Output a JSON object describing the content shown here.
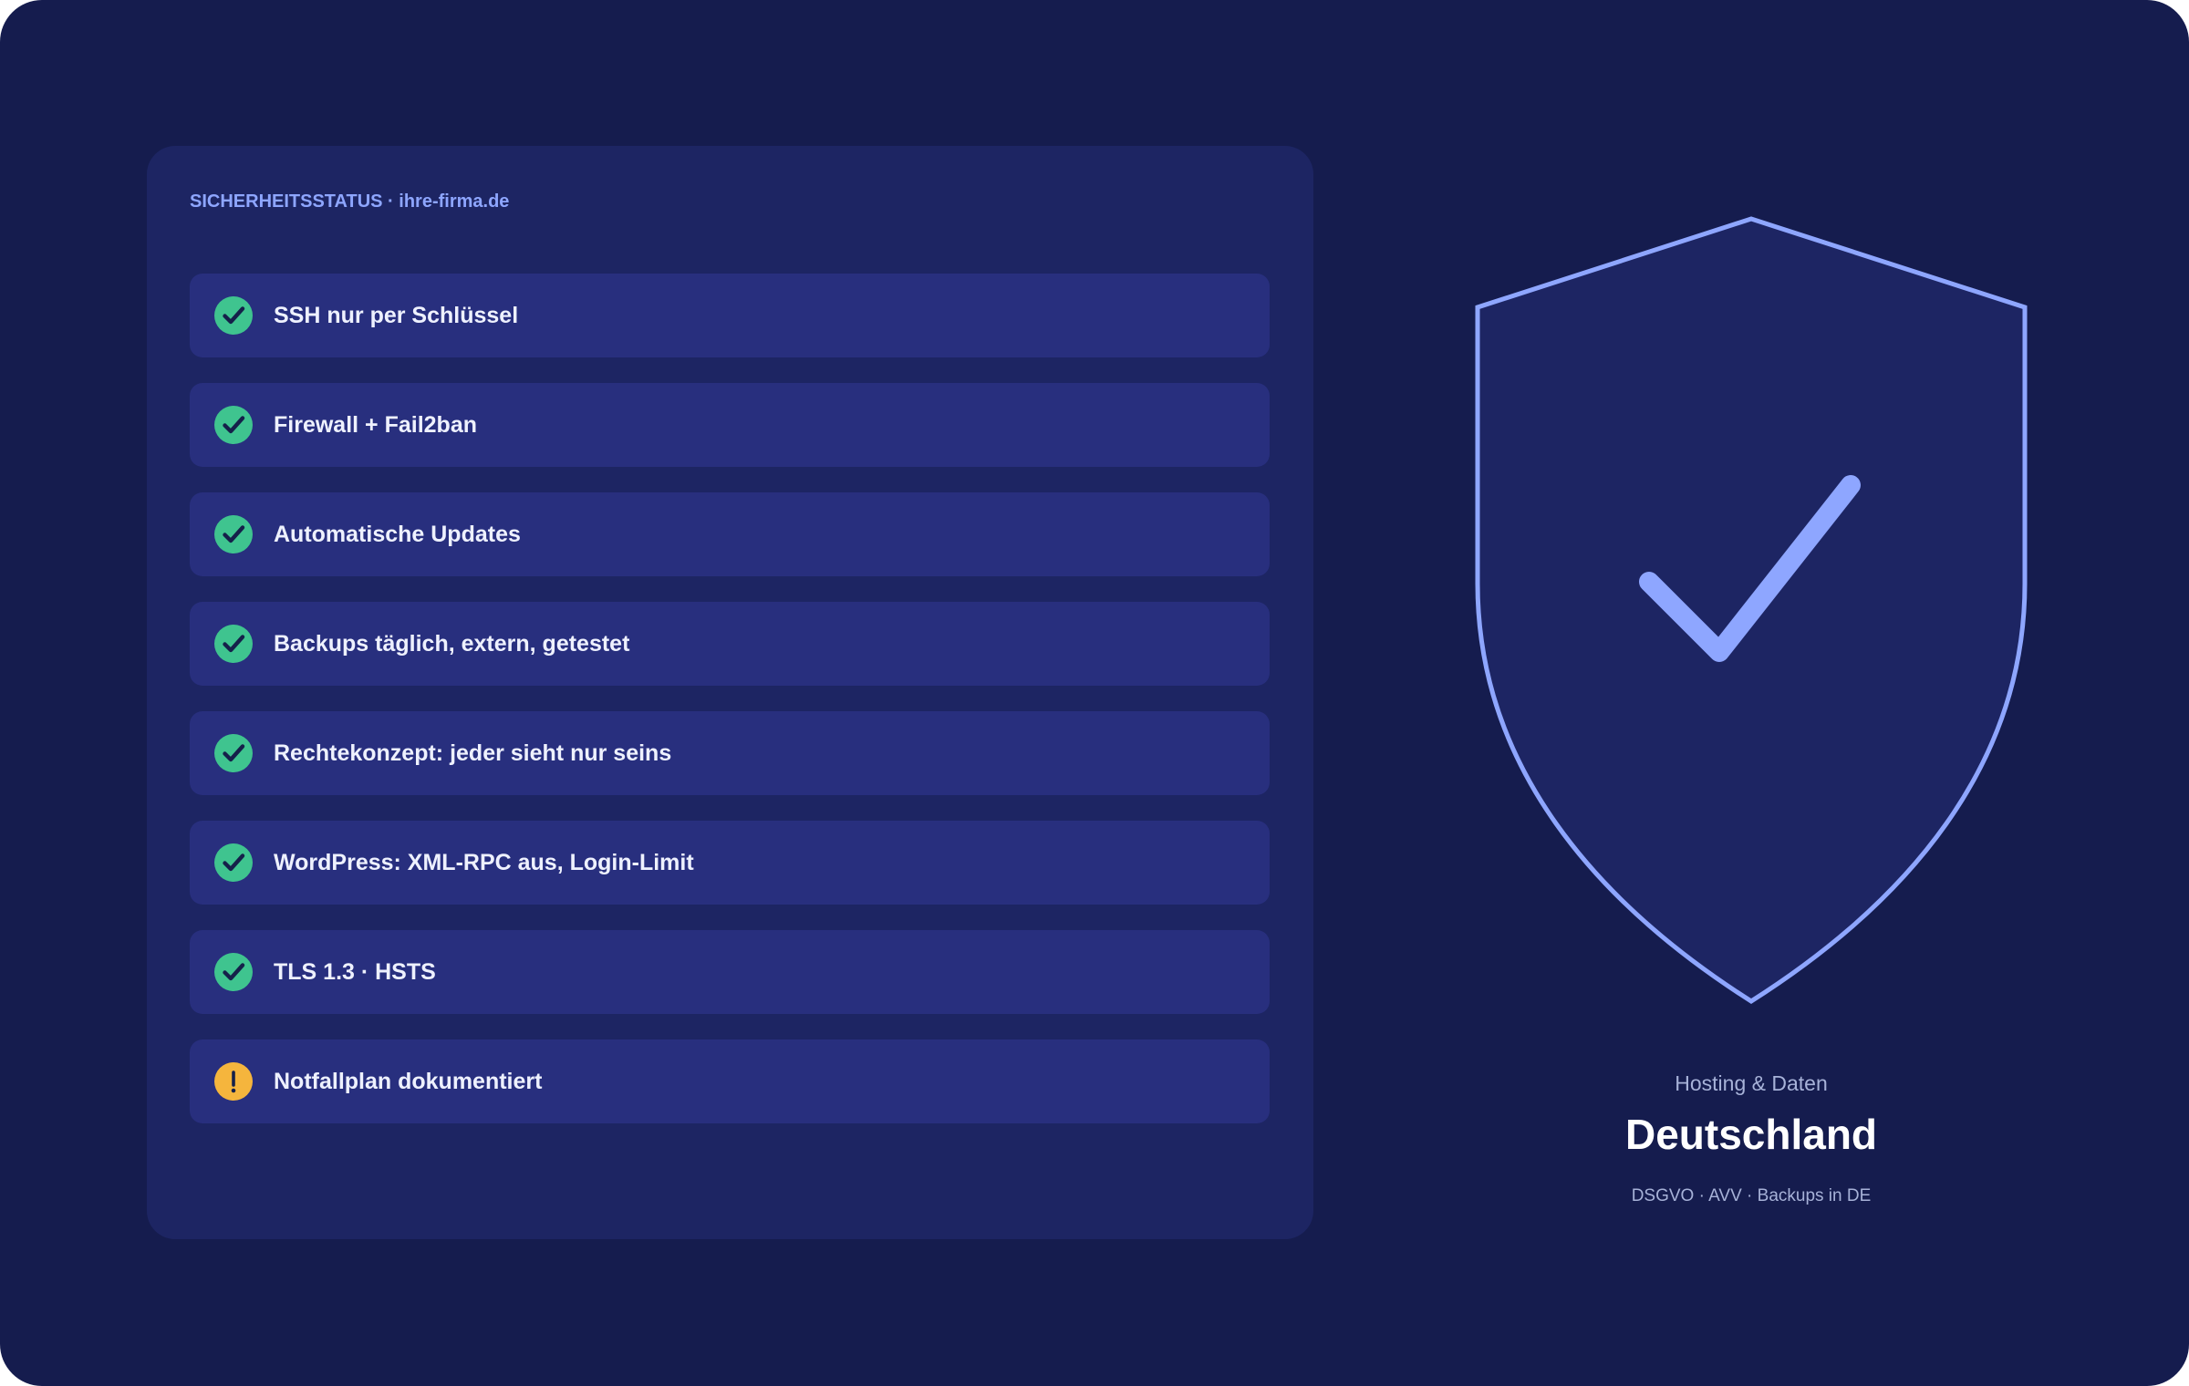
{
  "panel": {
    "header": "SICHERHEITSSTATUS · ihre-firma.de",
    "items": [
      {
        "label": "SSH nur per Schlüssel",
        "status": "ok",
        "icon": "check-circle-icon"
      },
      {
        "label": "Firewall + Fail2ban",
        "status": "ok",
        "icon": "check-circle-icon"
      },
      {
        "label": "Automatische Updates",
        "status": "ok",
        "icon": "check-circle-icon"
      },
      {
        "label": "Backups täglich, extern, getestet",
        "status": "ok",
        "icon": "check-circle-icon"
      },
      {
        "label": "Rechtekonzept: jeder sieht nur seins",
        "status": "ok",
        "icon": "check-circle-icon"
      },
      {
        "label": "WordPress: XML-RPC aus, Login-Limit",
        "status": "ok",
        "icon": "check-circle-icon"
      },
      {
        "label": "TLS 1.3 · HSTS",
        "status": "ok",
        "icon": "check-circle-icon"
      },
      {
        "label": "Notfallplan dokumentiert",
        "status": "warning",
        "icon": "warning-circle-icon"
      }
    ]
  },
  "badge": {
    "icon": "shield-check-icon",
    "caption": "Hosting & Daten",
    "country": "Deutschland",
    "compliance": "DSGVO · AVV · Backups in DE"
  },
  "colors": {
    "background": "#151c4e",
    "panel": "#1d2563",
    "row": "#282f7e",
    "accent": "#8ea6ff",
    "ok": "#3fc48f",
    "warning": "#f5b53d",
    "icon_mark": "#15204a"
  }
}
